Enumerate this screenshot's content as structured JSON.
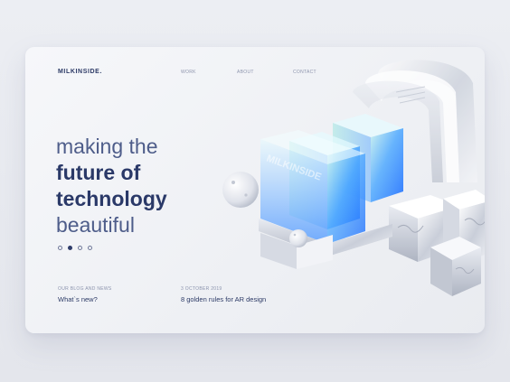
{
  "header": {
    "logo": "MILKINSIDE.",
    "nav": [
      "WORK",
      "ABOUT",
      "CONTACT"
    ]
  },
  "hero": {
    "line1": "making the",
    "line2": "future of",
    "line3": "technology",
    "line4": "beautiful"
  },
  "slider": {
    "count": 4,
    "active_index": 1
  },
  "posts": [
    {
      "meta": "OUR BLOG AND NEWS",
      "title": "What`s new?"
    },
    {
      "meta": "3 OCTOBER 2019",
      "title": "8 golden rules for AR design"
    }
  ],
  "artwork": {
    "glass_text": "MILKINSIDE"
  },
  "colors": {
    "brand_navy": "#2c3a66",
    "muted": "#8b93ad",
    "glass_blue": "#2f8cff",
    "glass_cyan": "#7fe6e6"
  }
}
